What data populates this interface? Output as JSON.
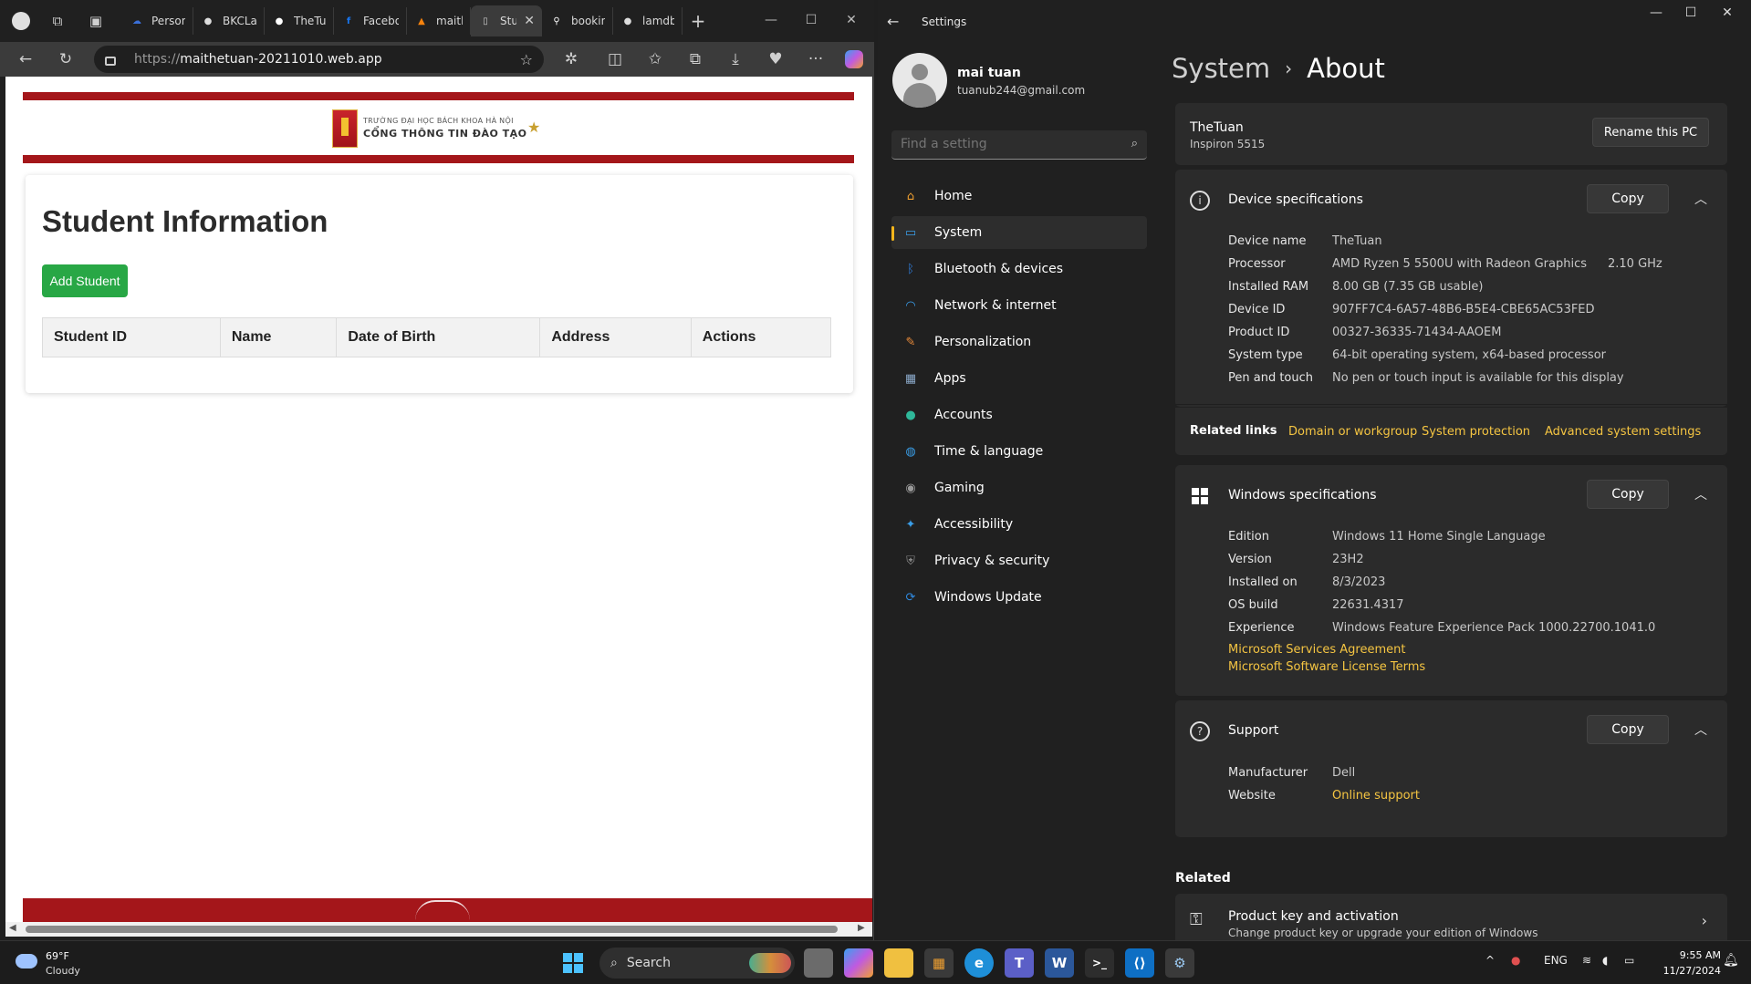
{
  "browser": {
    "tabs": [
      {
        "label": "Persona",
        "icon": "cloud-icon",
        "color": "#3a6fd8"
      },
      {
        "label": "BKCLab",
        "icon": "github-icon",
        "color": "#dddddd"
      },
      {
        "label": "TheTua",
        "icon": "github-icon",
        "color": "#ffffff"
      },
      {
        "label": "Faceboo",
        "icon": "facebook-icon",
        "color": "#1877f2"
      },
      {
        "label": "maithet",
        "icon": "firebase-icon",
        "color": "#f5820d"
      },
      {
        "label": "Stu",
        "icon": "page-icon",
        "color": "#cccccc",
        "active": true
      },
      {
        "label": "booking",
        "icon": "link-icon",
        "color": "#ffffff"
      },
      {
        "label": "lamdb/l",
        "icon": "github-icon",
        "color": "#dddddd"
      }
    ],
    "url_scheme": "https://",
    "url_host": "maithetuan-20211010.web.app"
  },
  "page": {
    "school_line1": "TRƯỜNG ĐẠI HỌC BÁCH KHOA HÀ NỘI",
    "school_line2": "CỔNG THÔNG TIN ĐÀO TẠO",
    "title": "Student Information",
    "add_button": "Add Student",
    "table_headers": [
      "Student ID",
      "Name",
      "Date of Birth",
      "Address",
      "Actions"
    ]
  },
  "settings": {
    "window_title": "Settings",
    "user_name": "mai tuan",
    "user_email": "tuanub244@gmail.com",
    "search_placeholder": "Find a setting",
    "nav": [
      {
        "label": "Home",
        "icon": "home-icon",
        "color": "#f0a030"
      },
      {
        "label": "System",
        "icon": "system-icon",
        "color": "#3a9ee8",
        "selected": true
      },
      {
        "label": "Bluetooth & devices",
        "icon": "bluetooth-icon",
        "color": "#2f7fe0"
      },
      {
        "label": "Network & internet",
        "icon": "wifi-icon",
        "color": "#3aa0f0"
      },
      {
        "label": "Personalization",
        "icon": "brush-icon",
        "color": "#e88a3a"
      },
      {
        "label": "Apps",
        "icon": "apps-icon",
        "color": "#8aa8c8"
      },
      {
        "label": "Accounts",
        "icon": "accounts-icon",
        "color": "#2fb89a"
      },
      {
        "label": "Time & language",
        "icon": "globe-icon",
        "color": "#3a9ee8"
      },
      {
        "label": "Gaming",
        "icon": "controller-icon",
        "color": "#9a9a9a"
      },
      {
        "label": "Accessibility",
        "icon": "accessibility-icon",
        "color": "#3a9ee8"
      },
      {
        "label": "Privacy & security",
        "icon": "shield-icon",
        "color": "#8a8a8a"
      },
      {
        "label": "Windows Update",
        "icon": "update-icon",
        "color": "#2f8ae0"
      }
    ],
    "breadcrumb_parent": "System",
    "breadcrumb_separator": "›",
    "breadcrumb_current": "About",
    "pc_name": "TheTuan",
    "pc_model": "Inspiron 5515",
    "rename_button": "Rename this PC",
    "copy_label": "Copy",
    "device_specs": {
      "title": "Device specifications",
      "rows": [
        {
          "k": "Device name",
          "v": "TheTuan",
          "v2": ""
        },
        {
          "k": "Processor",
          "v": "AMD Ryzen 5 5500U with Radeon Graphics",
          "v2": "2.10 GHz"
        },
        {
          "k": "Installed RAM",
          "v": "8.00 GB (7.35 GB usable)",
          "v2": ""
        },
        {
          "k": "Device ID",
          "v": "907FF7C4-6A57-48B6-B5E4-CBE65AC53FED",
          "v2": ""
        },
        {
          "k": "Product ID",
          "v": "00327-36335-71434-AAOEM",
          "v2": ""
        },
        {
          "k": "System type",
          "v": "64-bit operating system, x64-based processor",
          "v2": ""
        },
        {
          "k": "Pen and touch",
          "v": "No pen or touch input is available for this display",
          "v2": ""
        }
      ]
    },
    "related_links_label": "Related links",
    "related_links": [
      "Domain or workgroup",
      "System protection",
      "Advanced system settings"
    ],
    "windows_specs": {
      "title": "Windows specifications",
      "rows": [
        {
          "k": "Edition",
          "v": "Windows 11 Home Single Language"
        },
        {
          "k": "Version",
          "v": "23H2"
        },
        {
          "k": "Installed on",
          "v": "8/3/2023"
        },
        {
          "k": "OS build",
          "v": "22631.4317"
        },
        {
          "k": "Experience",
          "v": "Windows Feature Experience Pack 1000.22700.1041.0"
        }
      ],
      "links": [
        "Microsoft Services Agreement",
        "Microsoft Software License Terms"
      ]
    },
    "support": {
      "title": "Support",
      "manufacturer_label": "Manufacturer",
      "manufacturer": "Dell",
      "website_label": "Website",
      "website_link": "Online support"
    },
    "related_heading": "Related",
    "product_key_title": "Product key and activation",
    "product_key_sub": "Change product key or upgrade your edition of Windows"
  },
  "taskbar": {
    "weather_temp": "69°F",
    "weather_cond": "Cloudy",
    "search_label": "Search",
    "lang": "ENG",
    "time": "9:55 AM",
    "date": "11/27/2024"
  }
}
